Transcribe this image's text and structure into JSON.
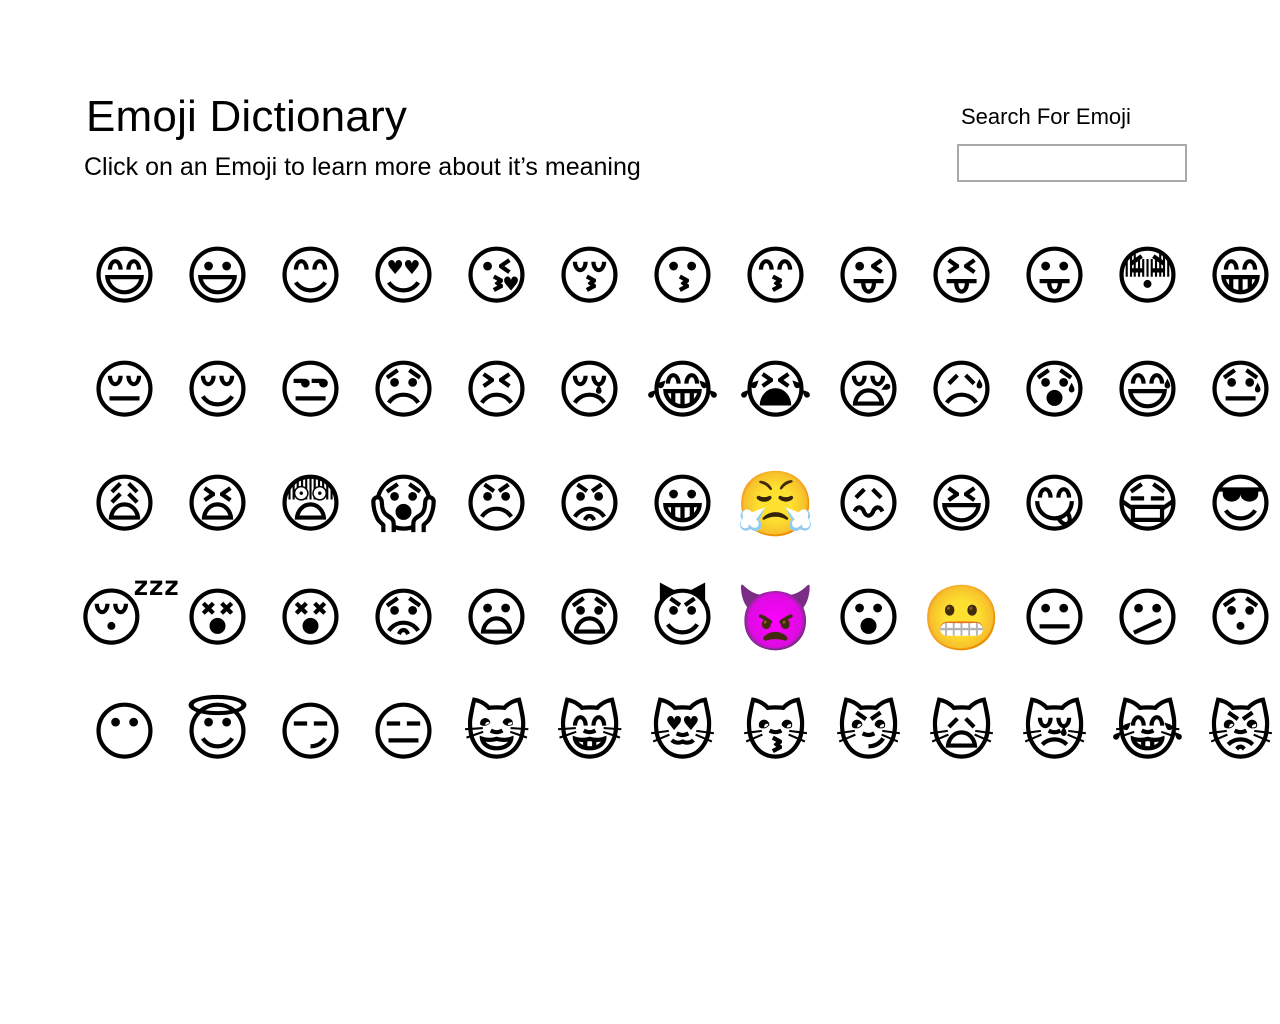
{
  "header": {
    "title": "Emoji Dictionary",
    "subtitle": "Click on an Emoji to learn more about it’s meaning"
  },
  "search": {
    "label": "Search For Emoji",
    "value": "",
    "placeholder": "",
    "border_color": "#a9a9a9"
  },
  "page": {
    "background_color": "#ffffff",
    "text_color": "#000000",
    "columns": 13,
    "rows": 5
  },
  "emoji_grid": {
    "rows": [
      [
        {
          "char": "😄",
          "name": "grinning-face-with-smiling-eyes"
        },
        {
          "char": "😃",
          "name": "grinning-face-with-big-eyes"
        },
        {
          "char": "😊",
          "name": "smiling-face-with-smiling-eyes"
        },
        {
          "char": "😍",
          "name": "smiling-face-with-heart-eyes"
        },
        {
          "char": "😘",
          "name": "face-blowing-a-kiss"
        },
        {
          "char": "😚",
          "name": "kissing-face-with-closed-eyes"
        },
        {
          "char": "😗",
          "name": "kissing-face"
        },
        {
          "char": "😙",
          "name": "kissing-face-with-smiling-eyes"
        },
        {
          "char": "😜",
          "name": "winking-face-with-tongue"
        },
        {
          "char": "😝",
          "name": "squinting-face-with-tongue"
        },
        {
          "char": "😛",
          "name": "face-with-tongue"
        },
        {
          "char": "😳",
          "name": "flushed-face"
        },
        {
          "char": "😁",
          "name": "beaming-face-with-smiling-eyes"
        }
      ],
      [
        {
          "char": "😔",
          "name": "pensive-face"
        },
        {
          "char": "😌",
          "name": "relieved-face"
        },
        {
          "char": "😒",
          "name": "unamused-face"
        },
        {
          "char": "😞",
          "name": "disappointed-face"
        },
        {
          "char": "😣",
          "name": "persevering-face"
        },
        {
          "char": "😢",
          "name": "crying-face"
        },
        {
          "char": "😂",
          "name": "face-with-tears-of-joy"
        },
        {
          "char": "😭",
          "name": "loudly-crying-face"
        },
        {
          "char": "😪",
          "name": "sleepy-face"
        },
        {
          "char": "😥",
          "name": "sad-but-relieved-face"
        },
        {
          "char": "😰",
          "name": "anxious-face-with-sweat"
        },
        {
          "char": "😅",
          "name": "grinning-face-with-sweat"
        },
        {
          "char": "😓",
          "name": "downcast-face-with-sweat"
        }
      ],
      [
        {
          "char": "😩",
          "name": "weary-face"
        },
        {
          "char": "😫",
          "name": "tired-face"
        },
        {
          "char": "😨",
          "name": "fearful-face"
        },
        {
          "char": "😱",
          "name": "face-screaming-in-fear"
        },
        {
          "char": "😠",
          "name": "angry-face"
        },
        {
          "char": "😡",
          "name": "enraged-face"
        },
        {
          "char": "😀",
          "name": "grinning-face"
        },
        {
          "char": "😤",
          "name": "face-with-steam-from-nose"
        },
        {
          "char": "😖",
          "name": "confounded-face"
        },
        {
          "char": "😆",
          "name": "grinning-squinting-face"
        },
        {
          "char": "😋",
          "name": "face-savoring-food"
        },
        {
          "char": "😷",
          "name": "face-with-medical-mask"
        },
        {
          "char": "😎",
          "name": "smiling-face-with-sunglasses"
        }
      ],
      [
        {
          "char": "😴",
          "name": "sleeping-face"
        },
        {
          "char": "😵",
          "name": "dizzy-face"
        },
        {
          "char": "😵",
          "name": "dizzy-face-open-mouth"
        },
        {
          "char": "😟",
          "name": "worried-face"
        },
        {
          "char": "😦",
          "name": "frowning-face-with-open-mouth"
        },
        {
          "char": "😧",
          "name": "anguished-face"
        },
        {
          "char": "😈",
          "name": "smiling-face-with-horns"
        },
        {
          "char": "👿",
          "name": "angry-face-with-horns"
        },
        {
          "char": "😮",
          "name": "face-with-open-mouth"
        },
        {
          "char": "😬",
          "name": "grimacing-face"
        },
        {
          "char": "😐",
          "name": "neutral-face"
        },
        {
          "char": "😕",
          "name": "confused-face"
        },
        {
          "char": "😯",
          "name": "hushed-face"
        }
      ],
      [
        {
          "char": "😶",
          "name": "face-without-mouth"
        },
        {
          "char": "😇",
          "name": "smiling-face-with-halo"
        },
        {
          "char": "😏",
          "name": "smirking-face"
        },
        {
          "char": "😑",
          "name": "expressionless-face"
        },
        {
          "char": "😺",
          "name": "grinning-cat"
        },
        {
          "char": "😸",
          "name": "grinning-cat-with-smiling-eyes"
        },
        {
          "char": "😻",
          "name": "smiling-cat-with-heart-eyes"
        },
        {
          "char": "😽",
          "name": "kissing-cat"
        },
        {
          "char": "😼",
          "name": "cat-with-wry-smile"
        },
        {
          "char": "🙀",
          "name": "weary-cat"
        },
        {
          "char": "😿",
          "name": "crying-cat"
        },
        {
          "char": "😹",
          "name": "cat-with-tears-of-joy"
        },
        {
          "char": "😾",
          "name": "pouting-cat"
        }
      ]
    ]
  }
}
